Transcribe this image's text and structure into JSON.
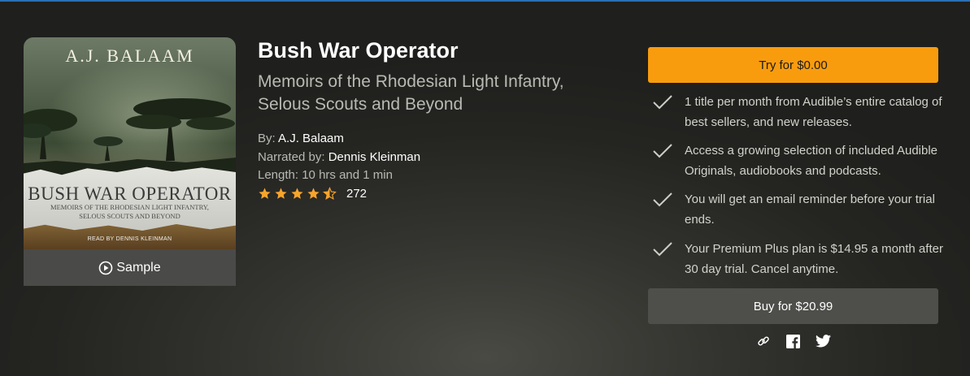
{
  "cover": {
    "author_text": "A.J. BALAAM",
    "title_text": "BUSH WAR OPERATOR",
    "subtitle_line1": "MEMOIRS OF THE RHODESIAN LIGHT INFANTRY,",
    "subtitle_line2": "SELOUS SCOUTS AND BEYOND",
    "narrator_text": "READ BY DENNIS KLEINMAN"
  },
  "sample_label": "Sample",
  "book": {
    "title": "Bush War Operator",
    "subtitle": "Memoirs of the Rhodesian Light Infantry, Selous Scouts and Beyond",
    "by_label": "By: ",
    "author": "A.J. Balaam",
    "narrated_label": "Narrated by: ",
    "narrator": "Dennis Kleinman",
    "length_label": "Length: ",
    "length": "10 hrs and 1 min",
    "rating_count": "272",
    "rating_stars": 4.5
  },
  "offer": {
    "try_label": "Try for $0.00",
    "benefits": [
      "1 title per month from Audible’s entire catalog of best sellers, and new releases.",
      "Access a growing selection of included Audible Originals, audiobooks and podcasts.",
      "You will get an email reminder before your trial ends.",
      "Your Premium Plus plan is $14.95 a month after 30 day trial. Cancel anytime."
    ],
    "buy_label": "Buy for $20.99"
  },
  "icons": {
    "check": "check-icon",
    "star": "star-icon",
    "play": "play-circle-icon",
    "link": "link-icon",
    "facebook": "facebook-icon",
    "twitter": "twitter-icon"
  },
  "colors": {
    "try_button": "#f89c0e",
    "buy_button": "#4e4e4b",
    "star": "#f7a42c"
  }
}
